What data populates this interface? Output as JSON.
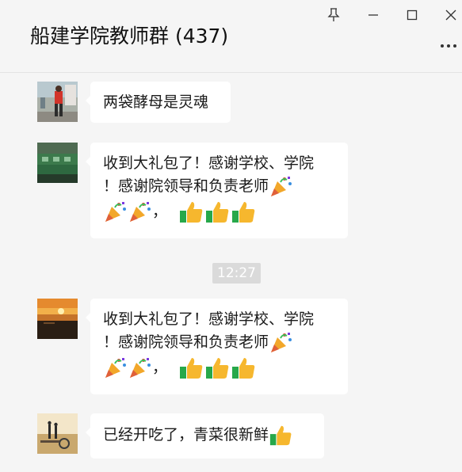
{
  "window": {
    "title": "船建学院教师群 (437)",
    "controls": [
      "pin-icon",
      "minimize-icon",
      "maximize-icon",
      "close-icon"
    ],
    "more_menu": "more-icon"
  },
  "colors": {
    "background": "#f5f5f5",
    "bubble": "#ffffff",
    "timestamp_bg": "#dadada",
    "text": "#1a1a1a"
  },
  "messages": [
    {
      "text": "两袋酵母是灵魂",
      "avatar": "avatar-person-running"
    },
    {
      "line1": "收到大礼包了！感谢学校、学院",
      "line2": "！感谢院领导和负责老师",
      "tail": "，",
      "emojis": [
        "party-popper-icon",
        "party-popper-icon",
        "party-popper-icon",
        "thumbs-up-icon",
        "thumbs-up-icon",
        "thumbs-up-icon"
      ],
      "avatar": "avatar-green-field"
    },
    {
      "line1": "收到大礼包了！感谢学校、学院",
      "line2": "！感谢院领导和负责老师",
      "tail": "，",
      "emojis": [
        "party-popper-icon",
        "party-popper-icon",
        "party-popper-icon",
        "thumbs-up-icon",
        "thumbs-up-icon",
        "thumbs-up-icon"
      ],
      "avatar": "avatar-sunset"
    },
    {
      "text": "已经开吃了，青菜很新鲜",
      "emojis": [
        "thumbs-up-icon"
      ],
      "avatar": "avatar-silhouettes"
    }
  ],
  "timestamp": "12:27"
}
